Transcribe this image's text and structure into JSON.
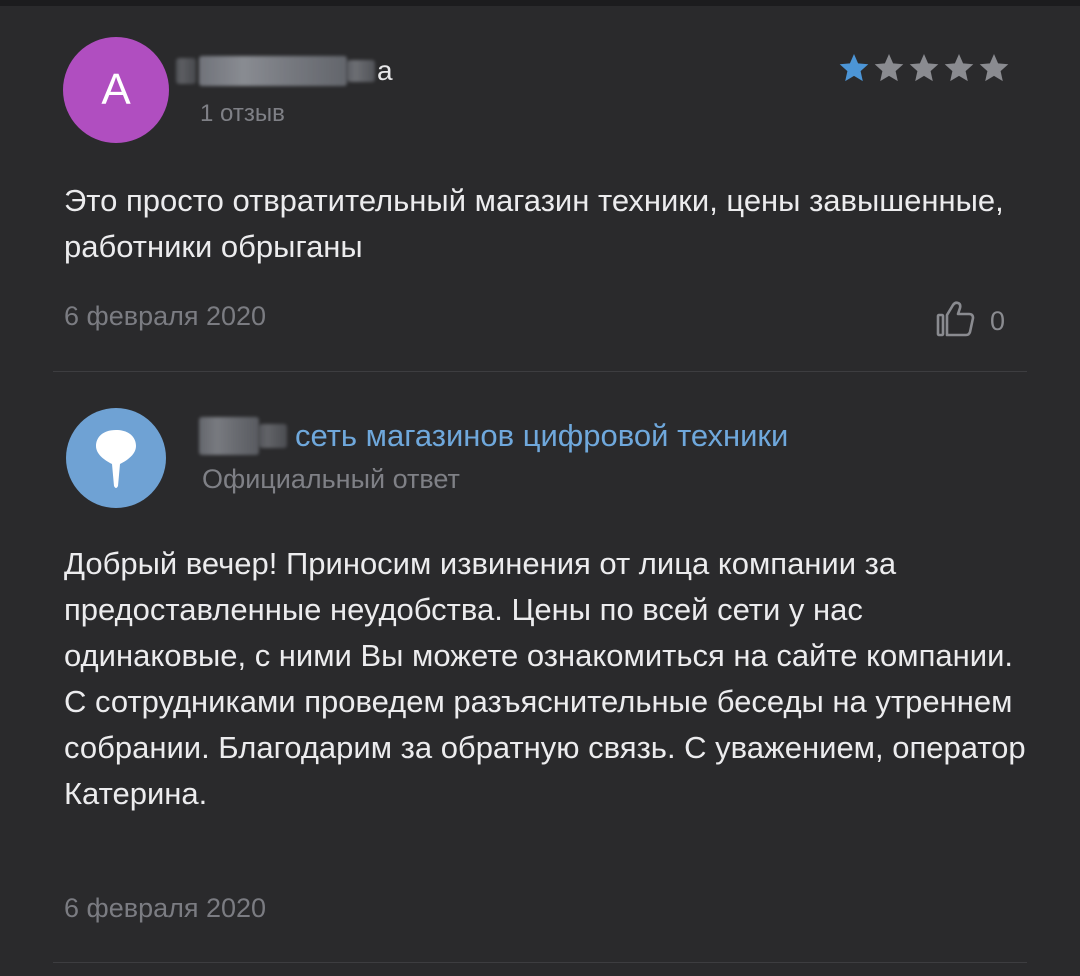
{
  "review": {
    "avatar_letter": "А",
    "avatar_color": "#b04ec0",
    "author_name_visible": "а",
    "author_reviews": "1 отзыв",
    "rating": 1,
    "max_rating": 5,
    "star_filled_color": "#4c95d6",
    "star_empty_color": "#8a8b90",
    "text": "Это просто отвратительный магазин техники, цены завышенные, работники обрыганы",
    "date": "6 февраля 2020",
    "like_icon": "thumbs-up-icon",
    "likes": "0"
  },
  "reply": {
    "avatar_color": "#6fa2d4",
    "avatar_icon": "brand-logo-icon",
    "org_name": "сеть магазинов цифровой техники",
    "badge": "Официальный ответ",
    "text": "Добрый вечер! Приносим извинения от лица компании за предоставленные неудобства. Цены по всей сети у нас одинаковые, с ними Вы можете ознакомиться на сайте компании. С сотрудниками проведем разъяснительные беседы на утреннем собрании. Благодарим за обратную связь. С уважением, оператор Катерина.",
    "date": "6 февраля 2020"
  }
}
